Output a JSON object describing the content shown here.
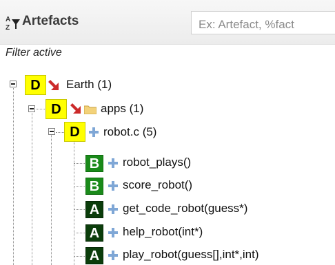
{
  "header": {
    "title": "Artefacts",
    "search_placeholder": "Ex: Artefact, %fact",
    "sort_icon": "sort-az-filter-icon"
  },
  "filter": {
    "status": "Filter active"
  },
  "colors": {
    "badge_D": "#ffff00",
    "badge_B": "#1a8a1a",
    "badge_A": "#0b3d0b",
    "arrow": "#cc2a2a",
    "plus": "#7fa7d6",
    "folder": "#f3d27a"
  },
  "tree": {
    "earth": {
      "badge": "D",
      "icon": "red-arrow-icon",
      "label": "Earth (1)"
    },
    "apps": {
      "badge": "D",
      "icon": "folder-icon",
      "label": "apps (1)"
    },
    "robot_c": {
      "badge": "D",
      "icon": "plus-icon",
      "label": "robot.c (5)"
    },
    "children": [
      {
        "badge": "B",
        "icon": "plus-icon",
        "label": "robot_plays()"
      },
      {
        "badge": "B",
        "icon": "plus-icon",
        "label": "score_robot()"
      },
      {
        "badge": "A",
        "icon": "plus-icon",
        "label": "get_code_robot(guess*)"
      },
      {
        "badge": "A",
        "icon": "plus-icon",
        "label": "help_robot(int*)"
      },
      {
        "badge": "A",
        "icon": "plus-icon",
        "label": "play_robot(guess[],int*,int)"
      }
    ]
  }
}
